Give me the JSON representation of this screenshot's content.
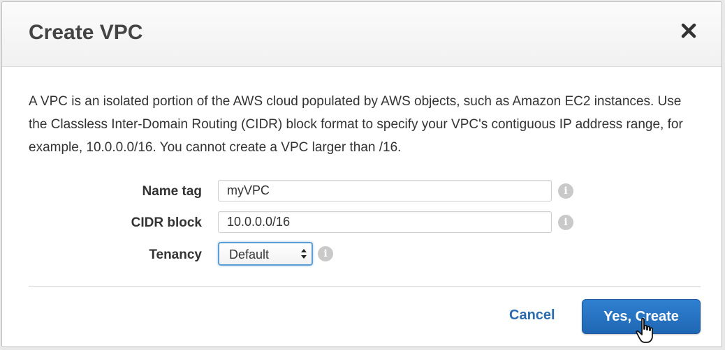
{
  "dialog": {
    "title": "Create VPC",
    "close_icon": "close-icon",
    "description": "A VPC is an isolated portion of the AWS cloud populated by AWS objects, such as Amazon EC2 instances. Use the Classless Inter-Domain Routing (CIDR) block format to specify your VPC's contiguous IP address range, for example, 10.0.0.0/16. You cannot create a VPC larger than /16."
  },
  "form": {
    "name_tag": {
      "label": "Name tag",
      "value": "myVPC",
      "info_icon": "info-icon"
    },
    "cidr_block": {
      "label": "CIDR block",
      "value": "10.0.0.0/16",
      "info_icon": "info-icon"
    },
    "tenancy": {
      "label": "Tenancy",
      "value": "Default",
      "options": [
        "Default"
      ],
      "info_icon": "info-icon"
    }
  },
  "footer": {
    "cancel_label": "Cancel",
    "create_label": "Yes, Create"
  },
  "colors": {
    "primary_button": "#2f80d1",
    "link": "#2b6cb0",
    "focus_ring": "#5e9ed6"
  },
  "cursor": "hand-pointer-icon"
}
